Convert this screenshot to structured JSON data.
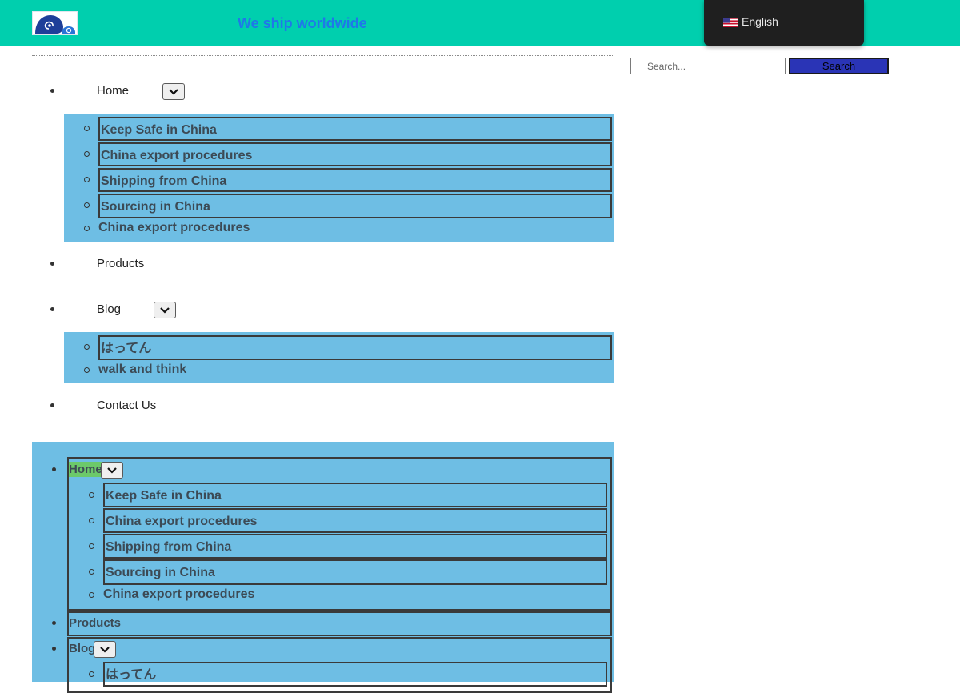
{
  "header": {
    "tagline": "We ship worldwide",
    "language": {
      "label": "English",
      "flag_icon": "us-flag-icon"
    }
  },
  "search": {
    "placeholder": "Search...",
    "button_label": "Search"
  },
  "nav": {
    "home": {
      "label": "Home",
      "children": [
        "Keep Safe in China",
        "China export procedures",
        "Shipping from China",
        "Sourcing in China"
      ],
      "extra": "China export procedures"
    },
    "products": {
      "label": "Products"
    },
    "blog": {
      "label": "Blog",
      "children": [
        "はってん"
      ],
      "extra": "walk and think"
    },
    "contact": {
      "label": "Contact Us"
    }
  },
  "mobile_nav": {
    "home": {
      "label": "Home",
      "children": [
        "Keep Safe in China",
        "China export procedures",
        "Shipping from China",
        "Sourcing in China"
      ],
      "extra": "China export procedures"
    },
    "products": {
      "label": "Products"
    },
    "blog": {
      "label": "Blog",
      "children": [
        "はってん"
      ]
    }
  },
  "colors": {
    "header_bg": "#00cfae",
    "tagline": "#1f78e8",
    "submenu_bg": "#6ebee4",
    "search_button": "#2a34b6",
    "home_highlight": "#6cc96a"
  }
}
